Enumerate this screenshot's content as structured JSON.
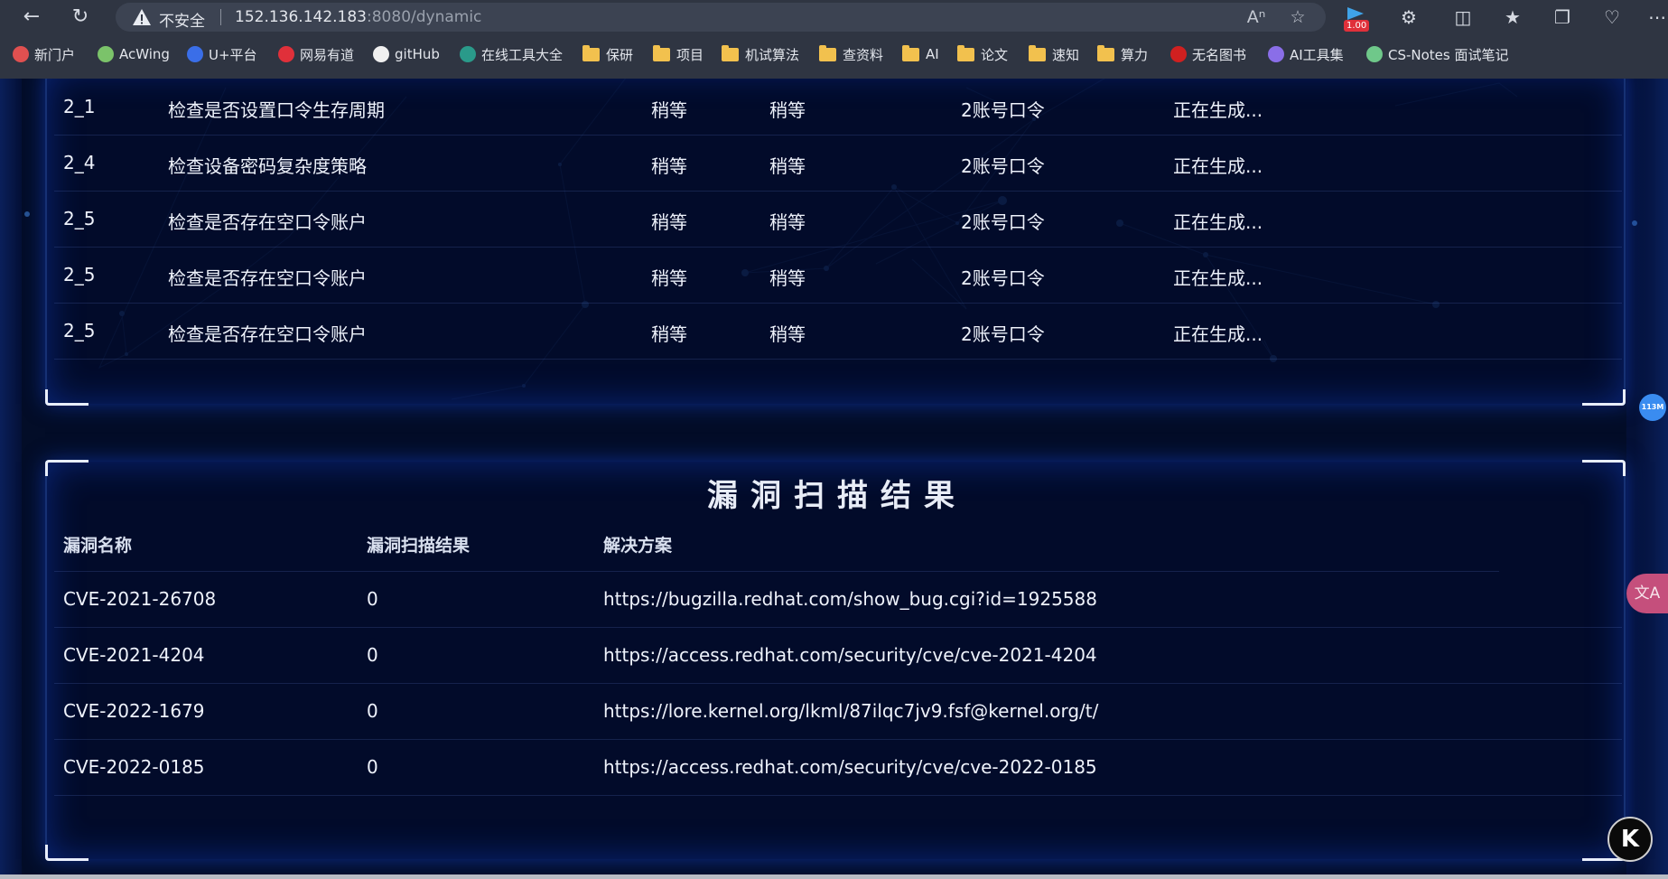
{
  "browser": {
    "security_label": "不安全",
    "url_host": "152.136.142.183",
    "url_path": ":8080/dynamic",
    "extension_badge": "1.00",
    "bookmarks": [
      {
        "label": "新门户",
        "icon": "portal-icon",
        "color": "#e05050"
      },
      {
        "label": "AcWing",
        "icon": "acwing-icon",
        "color": "#7bc36a"
      },
      {
        "label": "U+平台",
        "icon": "uplus-icon",
        "color": "#3a6ee8"
      },
      {
        "label": "网易有道",
        "icon": "youdao-icon",
        "color": "#e0303a"
      },
      {
        "label": "gitHub",
        "icon": "github-icon",
        "color": "#f0f0f0"
      },
      {
        "label": "在线工具大全",
        "icon": "tools-icon",
        "color": "#2a9a8a"
      },
      {
        "label": "保研",
        "icon": "folder-icon"
      },
      {
        "label": "项目",
        "icon": "folder-icon"
      },
      {
        "label": "机试算法",
        "icon": "folder-icon"
      },
      {
        "label": "查资料",
        "icon": "folder-icon"
      },
      {
        "label": "AI",
        "icon": "folder-icon"
      },
      {
        "label": "论文",
        "icon": "folder-icon"
      },
      {
        "label": "速知",
        "icon": "folder-icon"
      },
      {
        "label": "算力",
        "icon": "folder-icon"
      },
      {
        "label": "无名图书",
        "icon": "book-icon",
        "color": "#d02020"
      },
      {
        "label": "AI工具集",
        "icon": "aitools-icon",
        "color": "#8a6ee8"
      },
      {
        "label": "CS-Notes 面试笔记",
        "icon": "csnotes-icon",
        "color": "#6fc88a"
      }
    ]
  },
  "check_table": {
    "rows": [
      {
        "id": "2_1",
        "item": "检查是否设置口令生存周期",
        "level1": "稍等",
        "level2": "稍等",
        "category": "2账号口令",
        "status": "正在生成..."
      },
      {
        "id": "2_4",
        "item": "检查设备密码复杂度策略",
        "level1": "稍等",
        "level2": "稍等",
        "category": "2账号口令",
        "status": "正在生成..."
      },
      {
        "id": "2_5",
        "item": "检查是否存在空口令账户",
        "level1": "稍等",
        "level2": "稍等",
        "category": "2账号口令",
        "status": "正在生成..."
      },
      {
        "id": "2_5",
        "item": "检查是否存在空口令账户",
        "level1": "稍等",
        "level2": "稍等",
        "category": "2账号口令",
        "status": "正在生成..."
      },
      {
        "id": "2_5",
        "item": "检查是否存在空口令账户",
        "level1": "稍等",
        "level2": "稍等",
        "category": "2账号口令",
        "status": "正在生成..."
      }
    ]
  },
  "vuln_panel": {
    "title": "漏洞扫描结果",
    "headers": [
      "漏洞名称",
      "漏洞扫描结果",
      "解决方案"
    ],
    "rows": [
      {
        "name": "CVE-2021-26708",
        "result": "0",
        "solution": "https://bugzilla.redhat.com/show_bug.cgi?id=1925588"
      },
      {
        "name": "CVE-2021-4204",
        "result": "0",
        "solution": "https://access.redhat.com/security/cve/cve-2021-4204"
      },
      {
        "name": "CVE-2022-1679",
        "result": "0",
        "solution": "https://lore.kernel.org/lkml/87ilqc7jv9.fsf@kernel.org/t/"
      },
      {
        "name": "CVE-2022-0185",
        "result": "0",
        "solution": "https://access.redhat.com/security/cve/cve-2022-0185"
      }
    ]
  },
  "widgets": {
    "memory_badge": "113M",
    "translate_label": "文A",
    "k_button": "K"
  }
}
